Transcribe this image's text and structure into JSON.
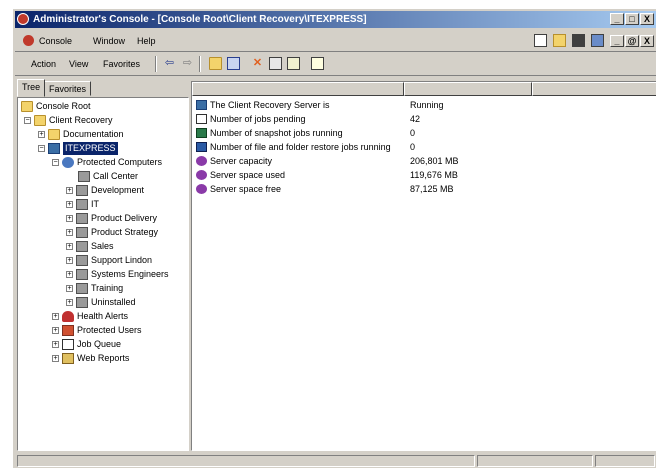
{
  "window": {
    "title": "Administrator's Console - [Console Root\\Client Recovery\\ITEXPRESS]",
    "controls": [
      "_",
      "□",
      "X"
    ]
  },
  "menubar": {
    "items": [
      "Console",
      "Window",
      "Help"
    ],
    "mdi_controls": [
      "_",
      "@",
      "X"
    ]
  },
  "toolbar": {
    "items": [
      "Action",
      "View",
      "Favorites"
    ]
  },
  "tabs": [
    "Tree",
    "Favorites"
  ],
  "tree": {
    "items": [
      {
        "label": "Console Root"
      },
      {
        "label": "Client Recovery"
      },
      {
        "label": "Documentation"
      },
      {
        "label": "ITEXPRESS"
      },
      {
        "label": "Protected Computers"
      },
      {
        "label": "Call Center"
      },
      {
        "label": "Development"
      },
      {
        "label": "IT"
      },
      {
        "label": "Product Delivery"
      },
      {
        "label": "Product Strategy"
      },
      {
        "label": "Sales"
      },
      {
        "label": "Support Lindon"
      },
      {
        "label": "Systems Engineers"
      },
      {
        "label": "Training"
      },
      {
        "label": "Uninstalled"
      },
      {
        "label": "Health Alerts"
      },
      {
        "label": "Protected Users"
      },
      {
        "label": "Job Queue"
      },
      {
        "label": "Web Reports"
      }
    ]
  },
  "list": {
    "rows": [
      {
        "name": "The Client Recovery Server is",
        "value": "Running"
      },
      {
        "name": "Number of jobs pending",
        "value": "42"
      },
      {
        "name": "Number of snapshot jobs running",
        "value": "0"
      },
      {
        "name": "Number of file and folder restore jobs running",
        "value": "0"
      },
      {
        "name": "Server capacity",
        "value": "206,801 MB"
      },
      {
        "name": "Server space used",
        "value": "119,676 MB"
      },
      {
        "name": "Server space free",
        "value": "87,125 MB"
      }
    ]
  },
  "colors": {
    "title_start": "#0a246a",
    "title_end": "#a6caf0",
    "chrome": "#d4d0c8",
    "selection": "#0a246a"
  }
}
